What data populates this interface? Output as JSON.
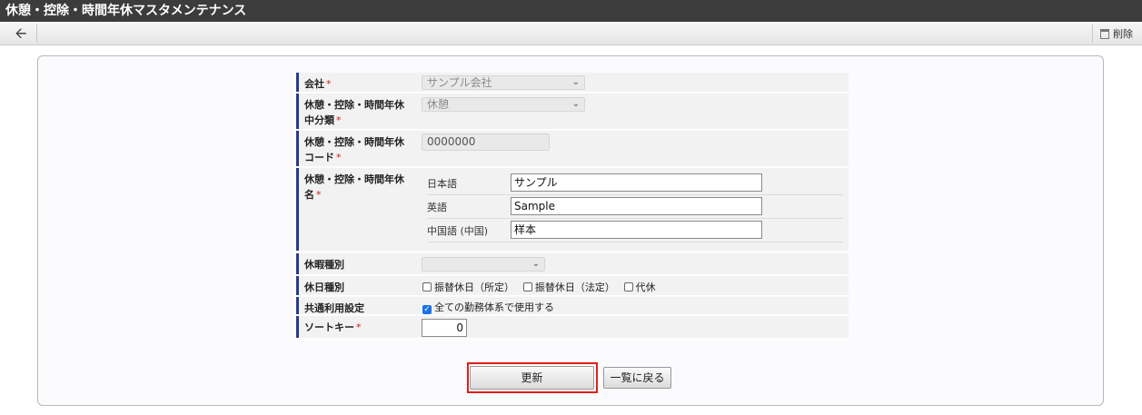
{
  "window": {
    "title": "休憩・控除・時間年休マスタメンテナンス"
  },
  "toolbar": {
    "back_icon": "arrow-left-icon",
    "delete_label": "削除",
    "delete_icon": "trash-icon"
  },
  "form": {
    "company": {
      "label": "会社",
      "required": "*",
      "value": "サンプル会社"
    },
    "category": {
      "label": "休憩・控除・時間年休中分類",
      "required": "*",
      "value": "休憩"
    },
    "code": {
      "label": "休憩・控除・時間年休コード",
      "required": "*",
      "value": "0000000"
    },
    "name": {
      "label": "休憩・控除・時間年休名",
      "required": "*",
      "langs": [
        {
          "label": "日本語",
          "value": "サンプル"
        },
        {
          "label": "英語",
          "value": "Sample"
        },
        {
          "label": "中国語 (中国)",
          "value": "样本"
        }
      ]
    },
    "leave_type": {
      "label": "休暇種別",
      "value": ""
    },
    "holiday_type": {
      "label": "休日種別",
      "options": [
        {
          "label": "振替休日（所定）",
          "checked": false
        },
        {
          "label": "振替休日（法定）",
          "checked": false
        },
        {
          "label": "代休",
          "checked": false
        }
      ]
    },
    "shared": {
      "label": "共通利用設定",
      "option_label": "全ての勤務体系で使用する",
      "checked": true
    },
    "sort_key": {
      "label": "ソートキー",
      "required": "*",
      "value": "0"
    }
  },
  "buttons": {
    "update": "更新",
    "back_to_list": "一覧に戻る"
  },
  "colors": {
    "title_bg": "#3c3c3c",
    "label_accent": "#283a8d",
    "required": "#d02020",
    "highlight": "#e0201c"
  }
}
